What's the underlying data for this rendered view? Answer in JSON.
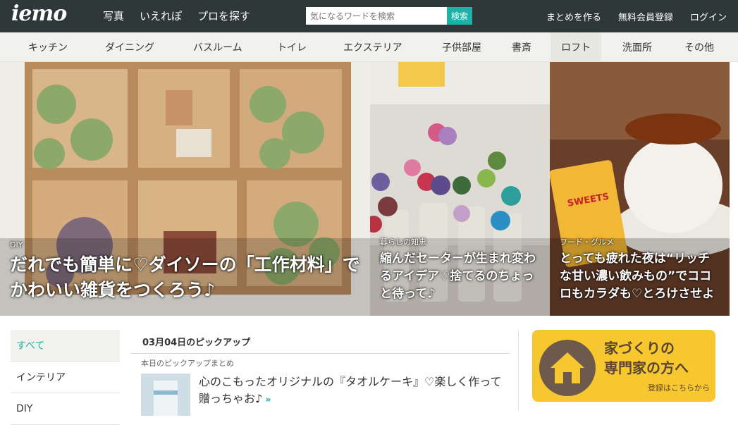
{
  "header": {
    "logo": "iemo",
    "nav": [
      "写真",
      "いえれぽ",
      "プロを探す"
    ],
    "search_placeholder": "気になるワードを検索",
    "search_button": "検索",
    "right": [
      "まとめを作る",
      "無料会員登録",
      "ログイン"
    ]
  },
  "categories": [
    "キッチン",
    "ダイニング",
    "バスルーム",
    "トイレ",
    "エクステリア",
    "子供部屋",
    "書斎",
    "ロフト",
    "洗面所",
    "その他"
  ],
  "hero": [
    {
      "tag": "DIY",
      "title": "だれでも簡単に♡ダイソーの「工作材料」でかわいい雑貨をつくろう♪"
    },
    {
      "tag": "暮らしの知恵",
      "title": "縮んだセーターが生まれ変わるアイデア♡捨てるのちょっと待って♪"
    },
    {
      "tag": "フード・グルメ",
      "title": "とっても疲れた夜は“リッチな甘い濃い飲みもの”でココロもカラダも♡とろけさせよ"
    }
  ],
  "sidebar": [
    "すべて",
    "インテリア",
    "DIY"
  ],
  "pickup": {
    "heading": "03月04日のピックアップ",
    "subheading": "本日のピックアップまとめ",
    "item_title": "心のこもったオリジナルの『タオルケーキ』♡楽しく作って贈っちゃお♪",
    "more": "»"
  },
  "banner": {
    "line1": "家づくりの",
    "line2": "専門家の方へ",
    "sub": "登録はこちらから"
  },
  "colors": {
    "topbar": "#2f3838",
    "accent": "#1ab3a6",
    "banner": "#f7c72f"
  }
}
